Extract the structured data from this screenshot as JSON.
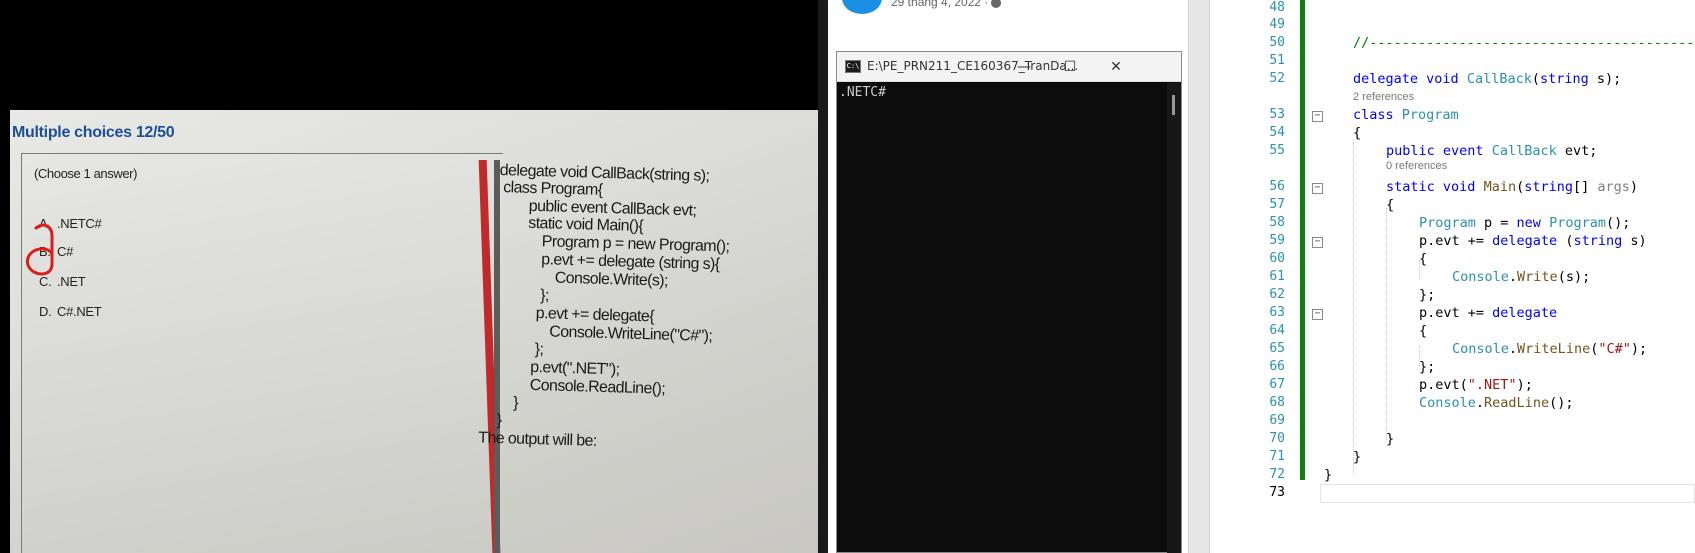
{
  "photo": {
    "title": "Multiple choices 12/50",
    "hint": "(Choose 1 answer)",
    "options": [
      {
        "letter": "A.",
        "text": ".NETC#"
      },
      {
        "letter": "B.",
        "text": "C#"
      },
      {
        "letter": "C.",
        "text": ".NET"
      },
      {
        "letter": "D.",
        "text": "C#.NET"
      }
    ],
    "code_lines": [
      "delegate void CallBack(string s);",
      "class Program{",
      "public event CallBack evt;",
      "static void Main(){",
      "Program p = new Program();",
      "p.evt += delegate (string s){",
      "Console.Write(s);",
      "};",
      "p.evt += delegate{",
      "Console.WriteLine(\"C#\");",
      "};",
      "p.evt(\".NET\");",
      "Console.ReadLine();",
      "}",
      "}",
      "The output will be:"
    ]
  },
  "facebook": {
    "date": "29 tháng 4, 2022 ·"
  },
  "console": {
    "title": "E:\\PE_PRN211_CE160367_TranDa...",
    "icon_text": "C:\\",
    "minimize": "—",
    "maximize": "☐",
    "close": "✕",
    "output": ".NETC#"
  },
  "editor": {
    "line_numbers": [
      "48",
      "49",
      "50",
      "51",
      "52",
      "53",
      "54",
      "55",
      "56",
      "57",
      "58",
      "59",
      "60",
      "61",
      "62",
      "63",
      "64",
      "65",
      "66",
      "67",
      "68",
      "69",
      "70",
      "71",
      "72",
      "73"
    ],
    "lens_2_refs": "2 references",
    "lens_0_refs": "0 references",
    "comment": "//----------------------------------------------------------------",
    "l52": {
      "kw1": "delegate",
      "kw2": "void",
      "ty": "CallBack",
      "p1": "(",
      "kw3": "string",
      "p2": " s);"
    },
    "l53": {
      "kw": "class",
      "ty": "Program"
    },
    "l54": "{",
    "l55": {
      "kw1": "public",
      "kw2": "event",
      "ty": "CallBack",
      "rest": " evt;"
    },
    "l56": {
      "kw1": "static",
      "kw2": "void",
      "fn": "Main",
      "p1": "(",
      "kw3": "string",
      "p2": "[] ",
      "pm": "args",
      "p3": ")"
    },
    "l57": "{",
    "l58": {
      "ty": "Program",
      "rest1": " p = ",
      "kw": "new",
      "ty2": "Program",
      "rest2": "();"
    },
    "l59": {
      "rest1": "p.evt += ",
      "kw": "delegate",
      "rest2": " (",
      "kw2": "string",
      "rest3": " s)"
    },
    "l60": "{",
    "l61": {
      "ty": "Console",
      "dot": ".",
      "fn": "Write",
      "rest": "(s);"
    },
    "l62": "};",
    "l63": {
      "rest1": "p.evt += ",
      "kw": "delegate"
    },
    "l64": "{",
    "l65": {
      "ty": "Console",
      "dot": ".",
      "fn": "WriteLine",
      "p1": "(",
      "st": "\"C#\"",
      "p2": ");"
    },
    "l66": "};",
    "l67": {
      "rest1": "p.evt(",
      "st": "\".NET\"",
      "rest2": ");"
    },
    "l68": {
      "ty": "Console",
      "dot": ".",
      "fn": "ReadLine",
      "rest": "();"
    },
    "l70": "}",
    "l71": "}",
    "l72": "}"
  }
}
